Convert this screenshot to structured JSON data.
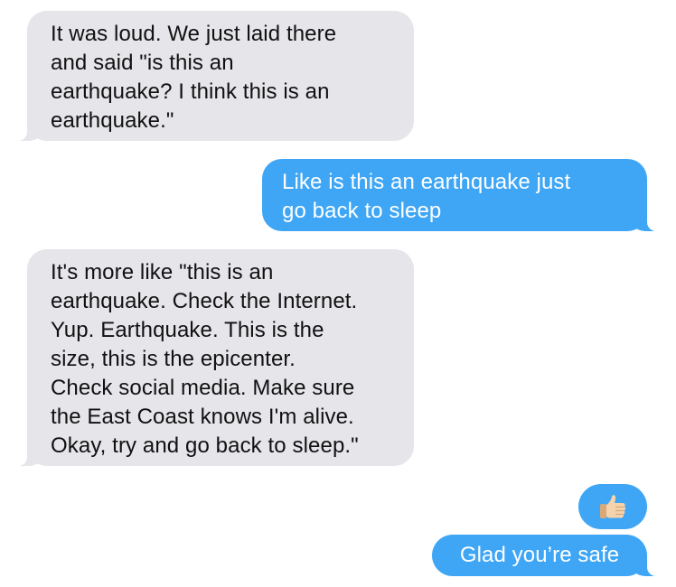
{
  "messages": [
    {
      "id": "msg1",
      "direction": "incoming",
      "text": "It was loud. We just laid there\nand said \"is this an\nearthquake? I think this is an\nearthquake.\""
    },
    {
      "id": "msg2",
      "direction": "outgoing",
      "text": "Like is this an earthquake just\ngo back to sleep"
    },
    {
      "id": "msg3",
      "direction": "incoming",
      "text": "It's more like \"this is an\nearthquake. Check the Internet.\nYup. Earthquake. This is the\nsize, this is the epicenter.\nCheck social media. Make sure\nthe East Coast knows I'm alive.\nOkay, try and go back to sleep.\""
    },
    {
      "id": "msg4",
      "direction": "outgoing",
      "icon": "thumbs-up-icon"
    },
    {
      "id": "msg5",
      "direction": "outgoing",
      "text": "Glad you’re safe"
    }
  ],
  "colors": {
    "incoming_bubble": "#e5e5ea",
    "outgoing_bubble": "#3ea6f5",
    "incoming_text": "#111111",
    "outgoing_text": "#ffffff"
  }
}
